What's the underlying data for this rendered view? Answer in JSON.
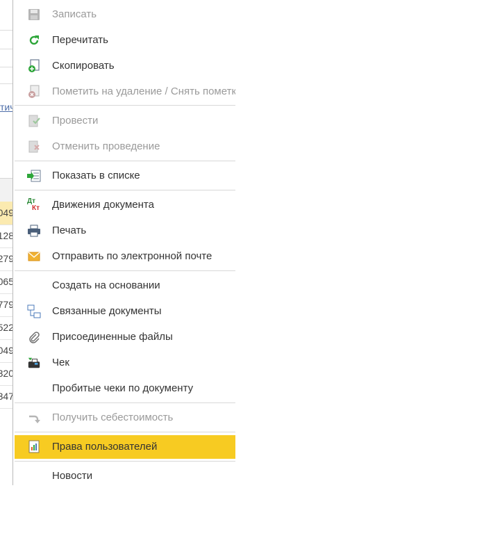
{
  "background": {
    "link_fragment": "тич",
    "table_values": [
      "049",
      "128",
      "279",
      "065",
      "779",
      "522",
      "049",
      "320",
      "347"
    ]
  },
  "menu": {
    "items": [
      {
        "label": "Записать",
        "icon": "save-icon",
        "disabled": true
      },
      {
        "label": "Перечитать",
        "icon": "refresh-icon",
        "disabled": false
      },
      {
        "label": "Скопировать",
        "icon": "copy-icon",
        "disabled": false
      },
      {
        "label": "Пометить на удаление / Снять пометку",
        "icon": "mark-delete-icon",
        "disabled": true
      },
      {
        "label": "Провести",
        "icon": "post-icon",
        "disabled": true
      },
      {
        "label": "Отменить проведение",
        "icon": "unpost-icon",
        "disabled": true
      },
      {
        "label": "Показать в списке",
        "icon": "show-in-list-icon",
        "disabled": false
      },
      {
        "label": "Движения документа",
        "icon": "dt-kt-icon",
        "disabled": false
      },
      {
        "label": "Печать",
        "icon": "print-icon",
        "disabled": false
      },
      {
        "label": "Отправить по электронной почте",
        "icon": "email-icon",
        "disabled": false
      },
      {
        "label": "Создать на основании",
        "icon": "",
        "disabled": false
      },
      {
        "label": "Связанные документы",
        "icon": "related-docs-icon",
        "disabled": false
      },
      {
        "label": "Присоединенные файлы",
        "icon": "paperclip-icon",
        "disabled": false
      },
      {
        "label": "Чек",
        "icon": "cash-register-icon",
        "disabled": false
      },
      {
        "label": "Пробитые чеки по документу",
        "icon": "",
        "disabled": false
      },
      {
        "label": "Получить себестоимость",
        "icon": "arrow-icon",
        "disabled": true
      },
      {
        "label": "Права пользователей",
        "icon": "user-rights-icon",
        "disabled": false,
        "highlighted": true
      },
      {
        "label": "Новости",
        "icon": "",
        "disabled": false
      }
    ],
    "dt_label": "Дт",
    "kt_label": "Кт",
    "highlight_color": "#f7cb22"
  }
}
